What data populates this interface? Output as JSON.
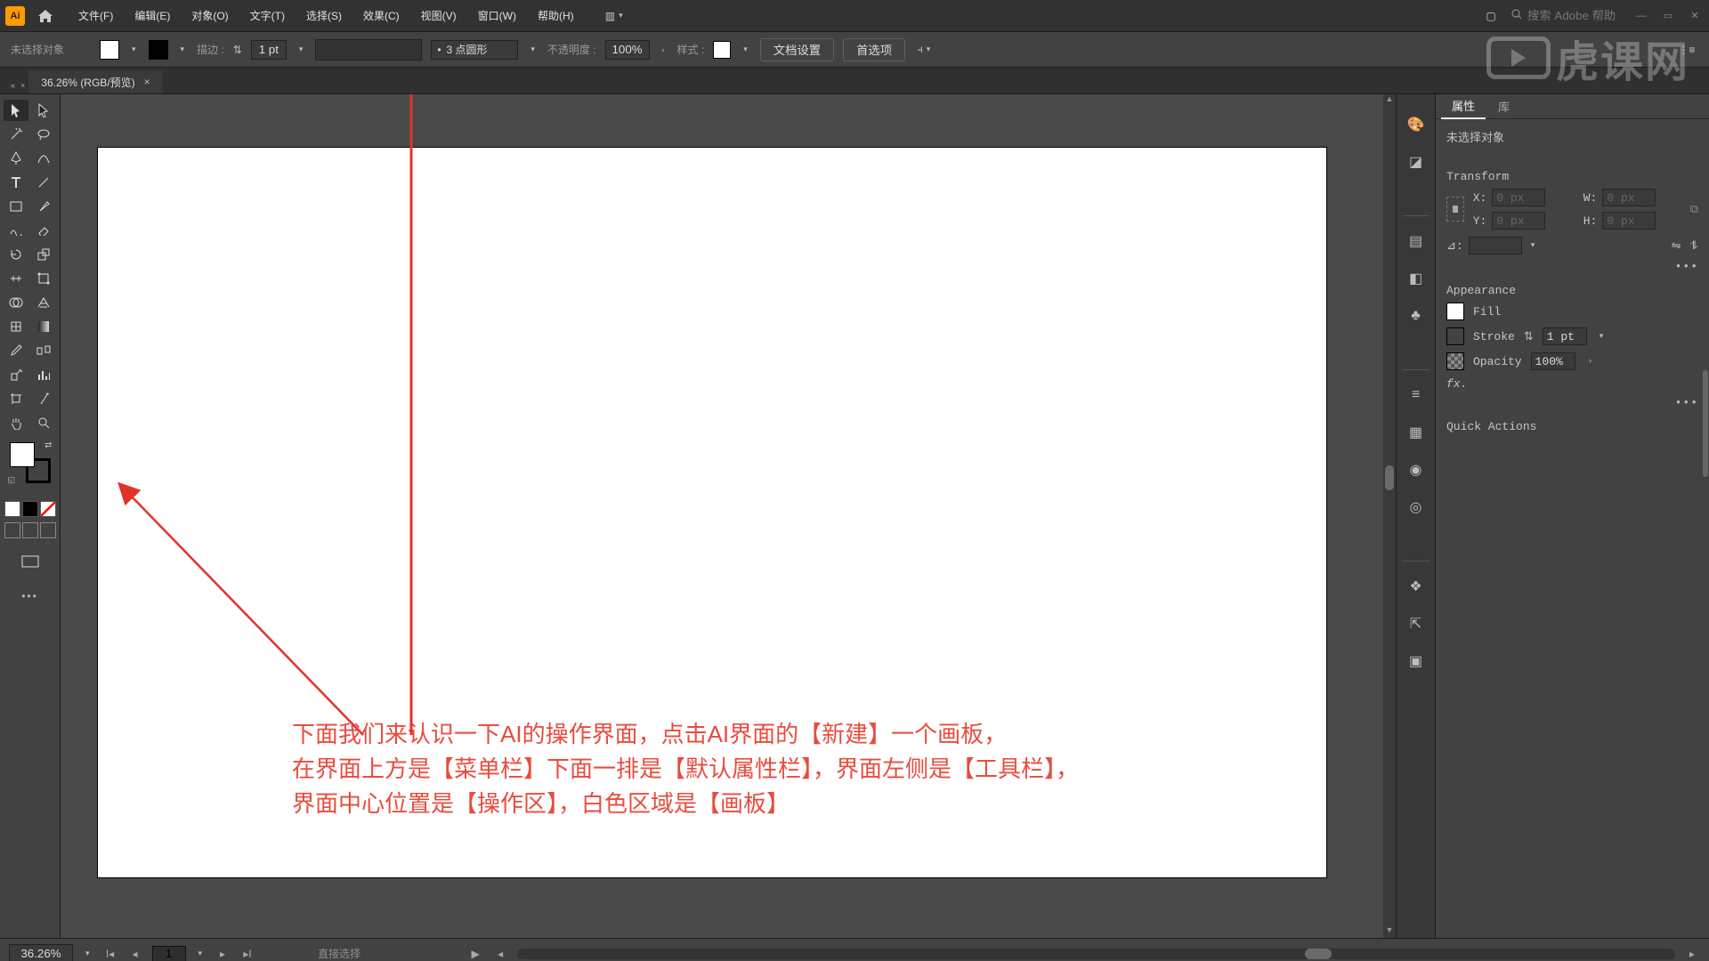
{
  "menubar": {
    "items": [
      "文件(F)",
      "编辑(E)",
      "对象(O)",
      "文字(T)",
      "选择(S)",
      "效果(C)",
      "视图(V)",
      "窗口(W)",
      "帮助(H)"
    ],
    "search_placeholder": "搜索 Adobe 帮助"
  },
  "controlbar": {
    "status": "未选择对象",
    "stroke_label": "描边 :",
    "stroke_value": "1 pt",
    "dash_value": "3 点圆形",
    "opacity_label": "不透明度 :",
    "opacity_value": "100%",
    "style_label": "样式 :",
    "doc_setup": "文档设置",
    "prefs": "首选项"
  },
  "doc_tab": {
    "title": "36.26% (RGB/预览)"
  },
  "properties": {
    "tabs": [
      "属性",
      "库"
    ],
    "no_sel": "未选择对象",
    "transform": "Transform",
    "x": "X:",
    "y": "Y:",
    "w": "W:",
    "h": "H:",
    "xval": "0 px",
    "yval": "0 px",
    "wval": "0 px",
    "hval": "0 px",
    "angle": "⊿:",
    "appearance": "Appearance",
    "fill": "Fill",
    "stroke": "Stroke",
    "stroke_val": "1 pt",
    "opacity": "Opacity",
    "opacity_val": "100%",
    "fx": "fx.",
    "quick": "Quick Actions"
  },
  "statusbar": {
    "zoom": "36.26%",
    "page": "1",
    "mode": "直接选择"
  },
  "annotation": {
    "line1": "下面我们来认识一下AI的操作界面，点击AI界面的【新建】一个画板，",
    "line2": "在界面上方是【菜单栏】下面一排是【默认属性栏】，界面左侧是【工具栏】，",
    "line3": "界面中心位置是【操作区】，白色区域是【画板】"
  },
  "watermark": "虎课网"
}
